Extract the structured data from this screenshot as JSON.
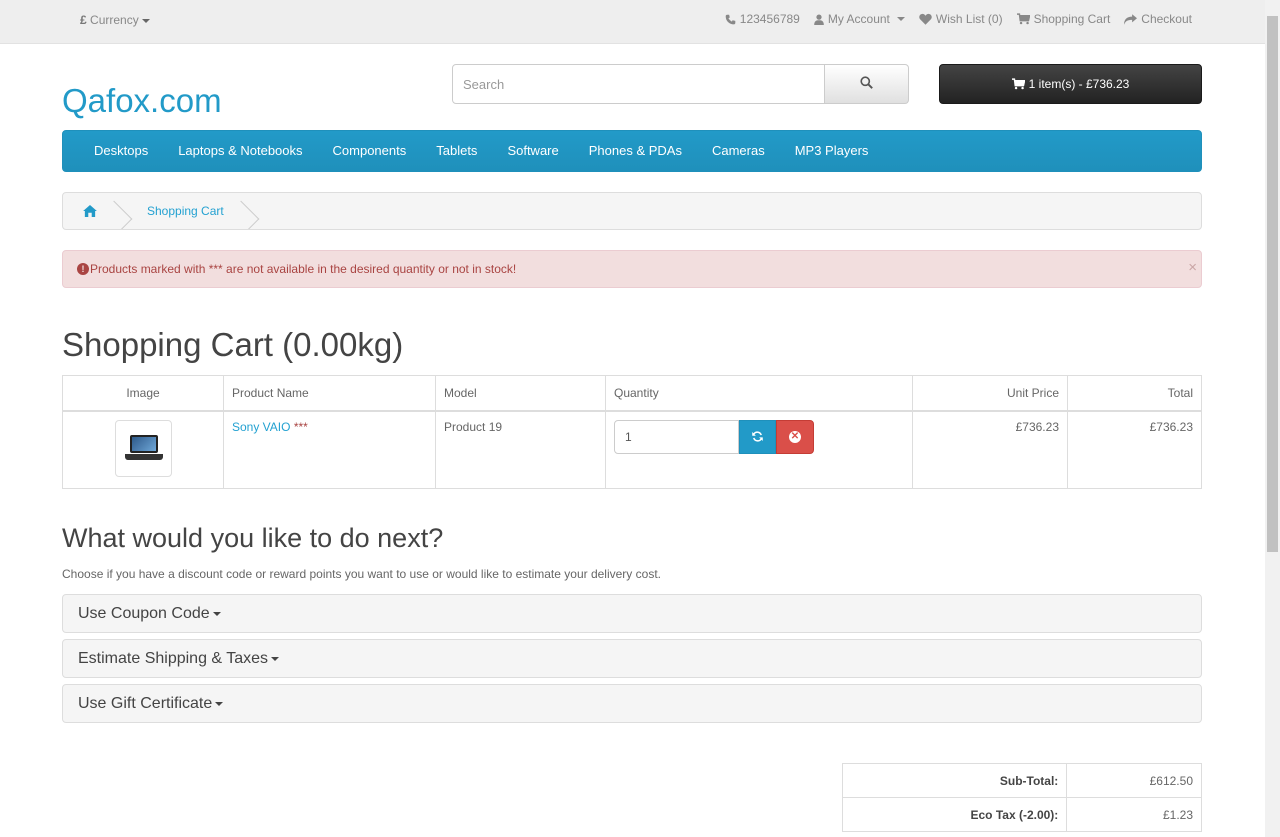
{
  "topbar": {
    "currency_symbol": "£",
    "currency_label": "Currency",
    "phone": "123456789",
    "my_account": "My Account",
    "wish_list": "Wish List (0)",
    "shopping_cart": "Shopping Cart",
    "checkout": "Checkout"
  },
  "header": {
    "logo": "Qafox.com",
    "search_placeholder": "Search",
    "cart_button": "1 item(s) - £736.23"
  },
  "menu": {
    "items": [
      "Desktops",
      "Laptops & Notebooks",
      "Components",
      "Tablets",
      "Software",
      "Phones & PDAs",
      "Cameras",
      "MP3 Players"
    ]
  },
  "breadcrumb": {
    "current": "Shopping Cart"
  },
  "alert": {
    "message": "Products marked with *** are not available in the desired quantity or not in stock!",
    "close": "×"
  },
  "page": {
    "title": "Shopping Cart  (0.00kg)"
  },
  "cart": {
    "headers": {
      "image": "Image",
      "name": "Product Name",
      "model": "Model",
      "quantity": "Quantity",
      "unit_price": "Unit Price",
      "total": "Total"
    },
    "rows": [
      {
        "name": "Sony VAIO",
        "stock_flag": "***",
        "model": "Product 19",
        "quantity": "1",
        "unit_price": "£736.23",
        "total": "£736.23"
      }
    ]
  },
  "next": {
    "title": "What would you like to do next?",
    "description": "Choose if you have a discount code or reward points you want to use or would like to estimate your delivery cost.",
    "panels": [
      "Use Coupon Code",
      "Estimate Shipping & Taxes",
      "Use Gift Certificate"
    ]
  },
  "totals": [
    {
      "label": "Sub-Total:",
      "value": "£612.50"
    },
    {
      "label": "Eco Tax (-2.00):",
      "value": "£1.23"
    }
  ],
  "colors": {
    "brand_blue": "#229ac8",
    "danger_red": "#da4f49",
    "alert_bg": "#f2dede",
    "alert_text": "#a94442"
  },
  "icons": [
    "phone-icon",
    "user-icon",
    "heart-icon",
    "cart-icon",
    "share-icon",
    "search-icon",
    "home-icon",
    "refresh-icon",
    "remove-icon",
    "exclamation-circle-icon"
  ]
}
